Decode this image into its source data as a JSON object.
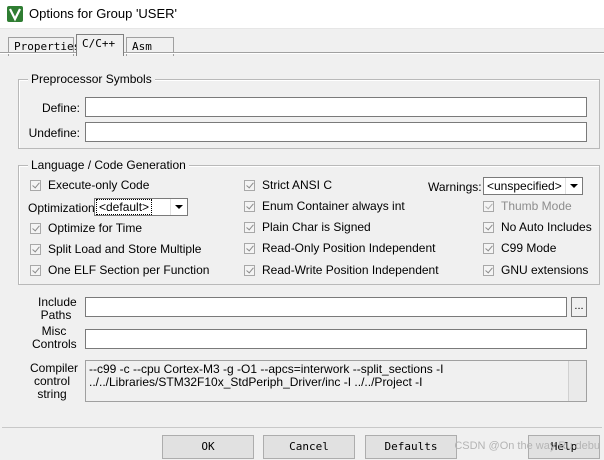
{
  "window": {
    "title": "Options for Group 'USER'"
  },
  "tabs": [
    {
      "label": "Properties",
      "active": false
    },
    {
      "label": "C/C++",
      "active": true
    },
    {
      "label": "Asm",
      "active": false
    }
  ],
  "preprocessor": {
    "group_title": "Preprocessor Symbols",
    "define_label": "Define:",
    "define_value": "",
    "undefine_label": "Undefine:",
    "undefine_value": ""
  },
  "language": {
    "group_title": "Language / Code Generation",
    "execute_only": {
      "label": "Execute-only Code",
      "checked": false
    },
    "optimization_label": "Optimization:",
    "optimization_value": "<default>",
    "optimize_time": {
      "label": "Optimize for Time",
      "checked": false
    },
    "split_load_store": {
      "label": "Split Load and Store Multiple",
      "checked": false
    },
    "one_elf": {
      "label": "One ELF Section per Function",
      "checked": true
    },
    "strict_ansi": {
      "label": "Strict ANSI C",
      "checked": false
    },
    "enum_container": {
      "label": "Enum Container always int",
      "checked": false
    },
    "plain_char": {
      "label": "Plain Char is Signed",
      "checked": false
    },
    "ro_pi": {
      "label": "Read-Only Position Independent",
      "checked": false
    },
    "rw_pi": {
      "label": "Read-Write Position Independent",
      "checked": false
    },
    "warnings_label": "Warnings:",
    "warnings_value": "<unspecified>",
    "thumb_mode": {
      "label": "Thumb Mode",
      "checked": false,
      "disabled": true
    },
    "no_auto_includes": {
      "label": "No Auto Includes",
      "checked": false
    },
    "c99_mode": {
      "label": "C99 Mode",
      "checked": true
    },
    "gnu_extensions": {
      "label": "GNU extensions",
      "checked": true
    }
  },
  "paths": {
    "include_label_line1": "Include",
    "include_label_line2": "Paths",
    "include_value": "",
    "browse_label": "...",
    "misc_label_line1": "Misc",
    "misc_label_line2": "Controls",
    "misc_value": "",
    "compiler_label_line1": "Compiler",
    "compiler_label_line2": "control",
    "compiler_label_line3": "string",
    "compiler_line1": "--c99 -c --cpu Cortex-M3 -g -O1 --apcs=interwork --split_sections -I",
    "compiler_line2": "../../Libraries/STM32F10x_StdPeriph_Driver/inc -I ../../Project -I"
  },
  "buttons": {
    "ok": "OK",
    "cancel": "Cancel",
    "defaults": "Defaults",
    "help": "Help"
  },
  "watermark": "CSDN @On the way Ru debu"
}
